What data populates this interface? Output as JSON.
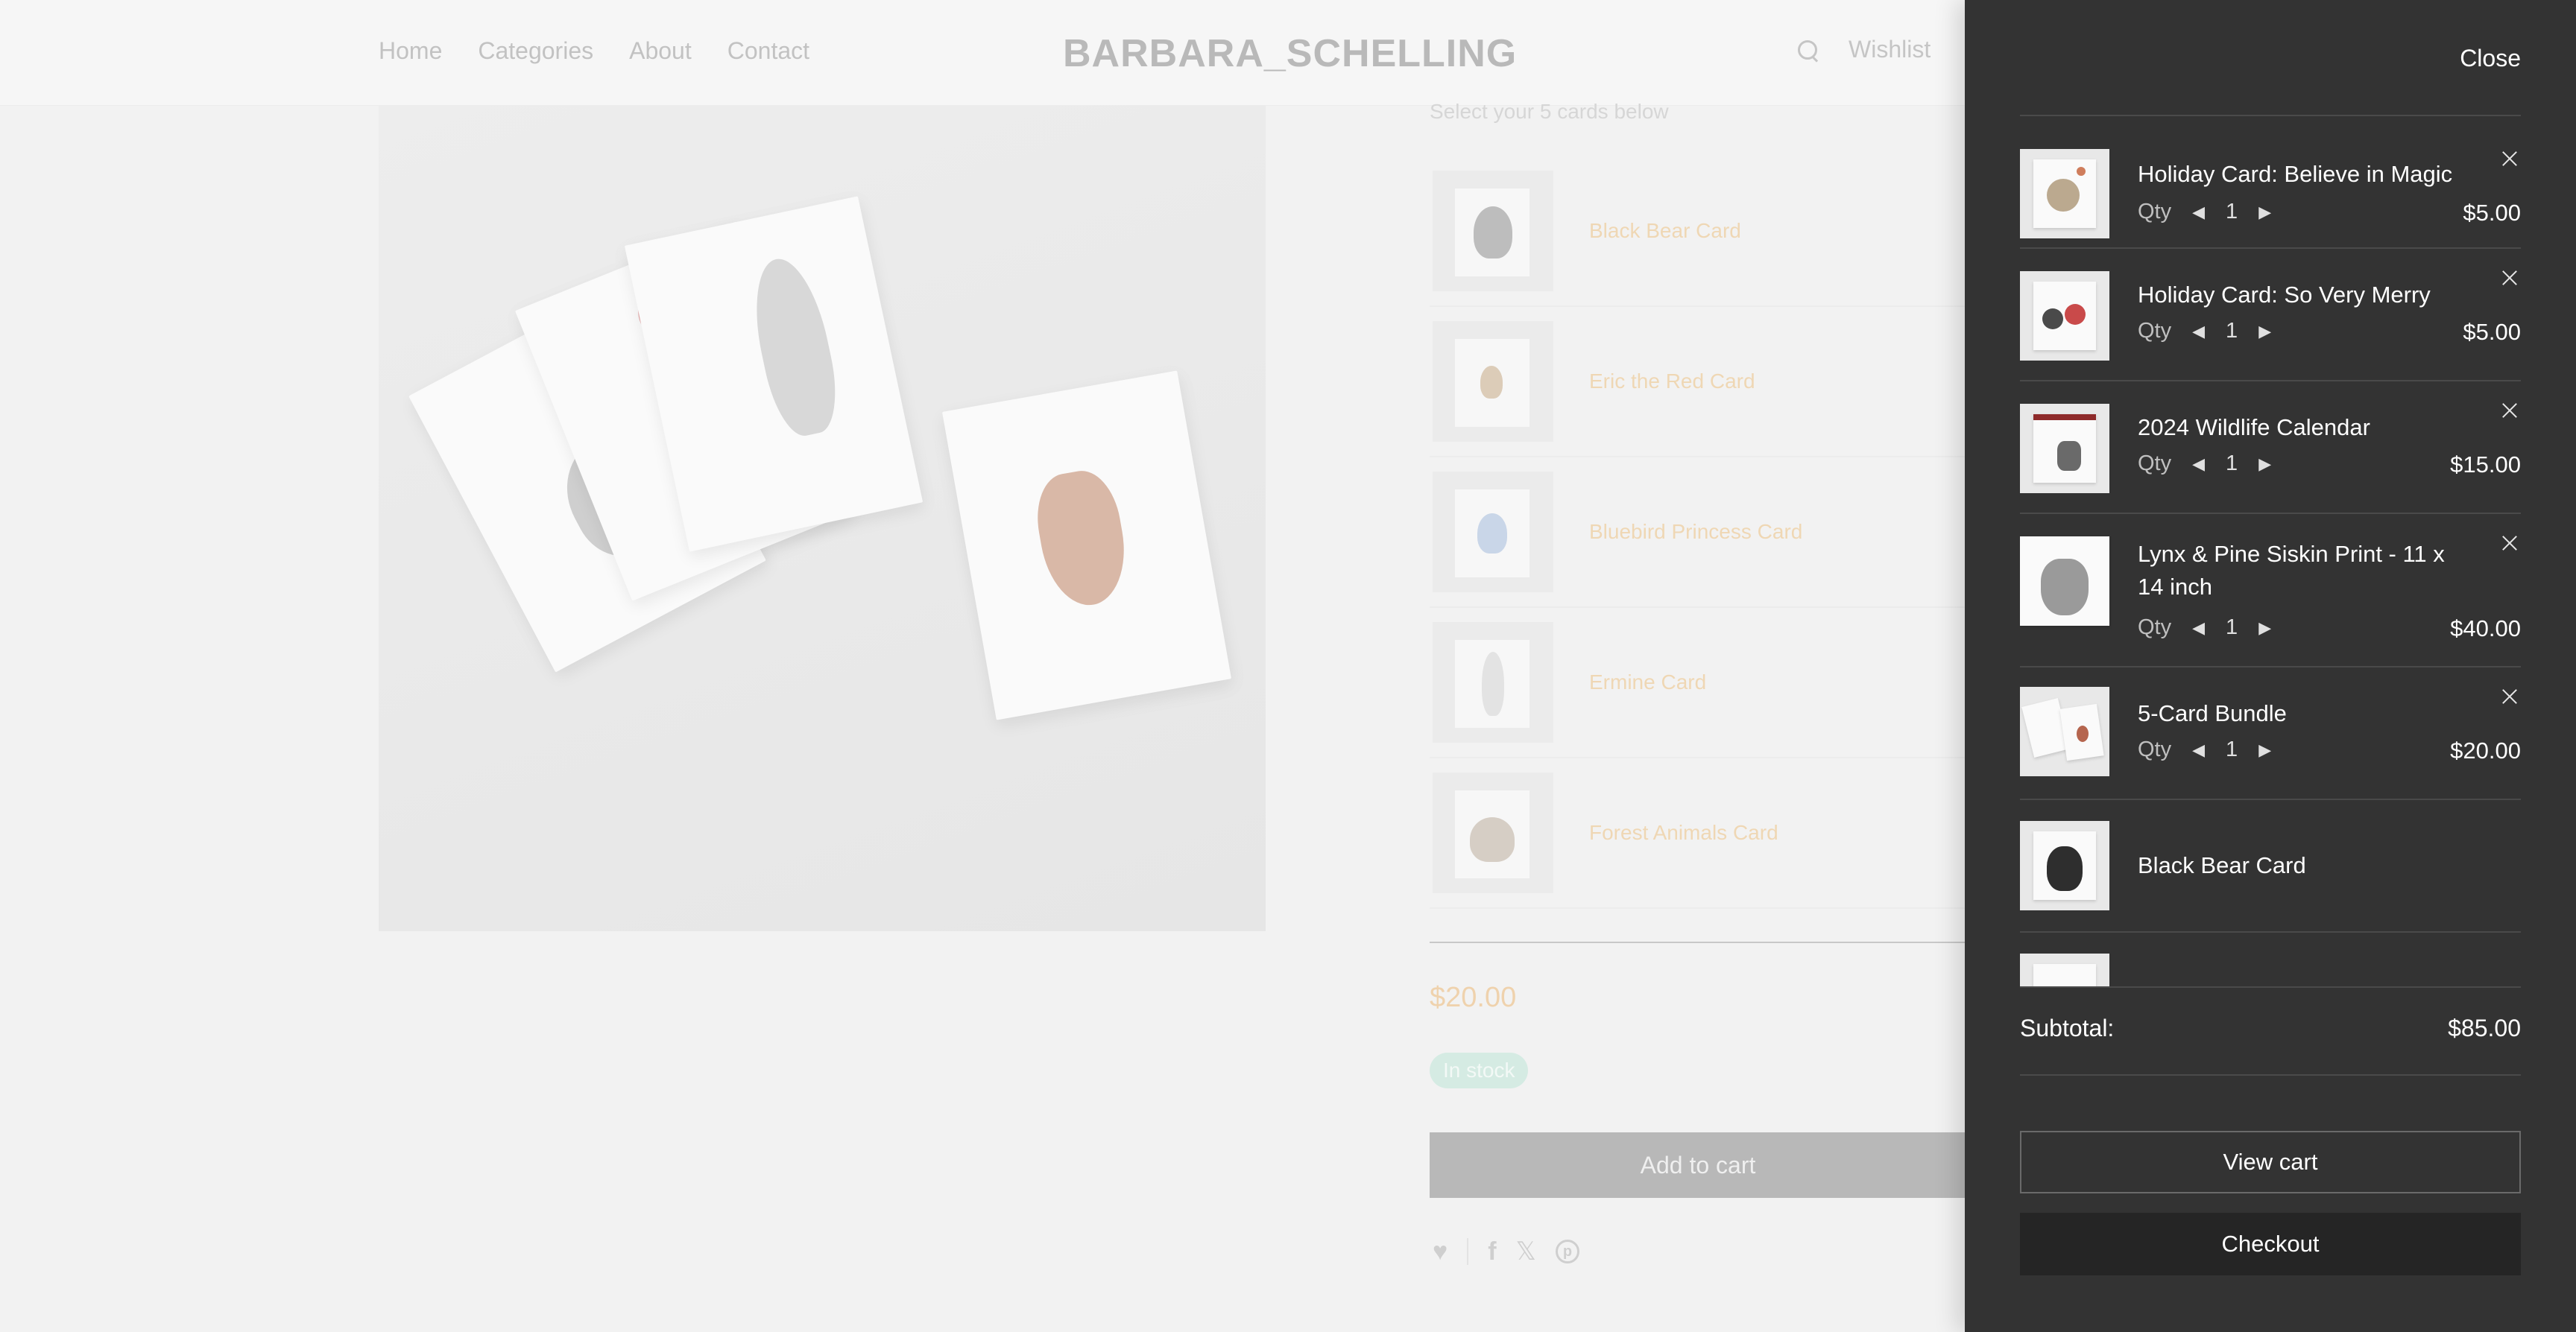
{
  "header": {
    "nav": [
      "Home",
      "Categories",
      "About",
      "Contact"
    ],
    "brand": "BARBARA_SCHELLING",
    "wishlist": "Wishlist"
  },
  "product": {
    "select_note": "Select your 5 cards below",
    "cards": [
      "Black Bear Card",
      "Eric the Red Card",
      "Bluebird Princess Card",
      "Ermine Card",
      "Forest Animals Card"
    ],
    "price": "$20.00",
    "stock": "In stock",
    "add_to_cart": "Add to cart"
  },
  "drawer": {
    "close": "Close",
    "qty_label": "Qty",
    "items": [
      {
        "title": "Holiday Card: Believe in Magic",
        "qty": "1",
        "price": "$5.00"
      },
      {
        "title": "Holiday Card: So Very Merry",
        "qty": "1",
        "price": "$5.00"
      },
      {
        "title": "2024 Wildlife Calendar",
        "qty": "1",
        "price": "$15.00"
      },
      {
        "title": "Lynx & Pine Siskin Print - 11 x 14 inch",
        "qty": "1",
        "price": "$40.00"
      },
      {
        "title": "5-Card Bundle",
        "qty": "1",
        "price": "$20.00"
      },
      {
        "title": "Black Bear Card"
      }
    ],
    "subtotal_label": "Subtotal:",
    "subtotal_value": "$85.00",
    "view_cart": "View cart",
    "checkout": "Checkout"
  },
  "icons": {
    "search": "search-icon",
    "remove": "close-icon",
    "heart": "heart-icon",
    "facebook": "facebook-icon",
    "x": "x-icon",
    "pinterest": "pinterest-icon"
  }
}
